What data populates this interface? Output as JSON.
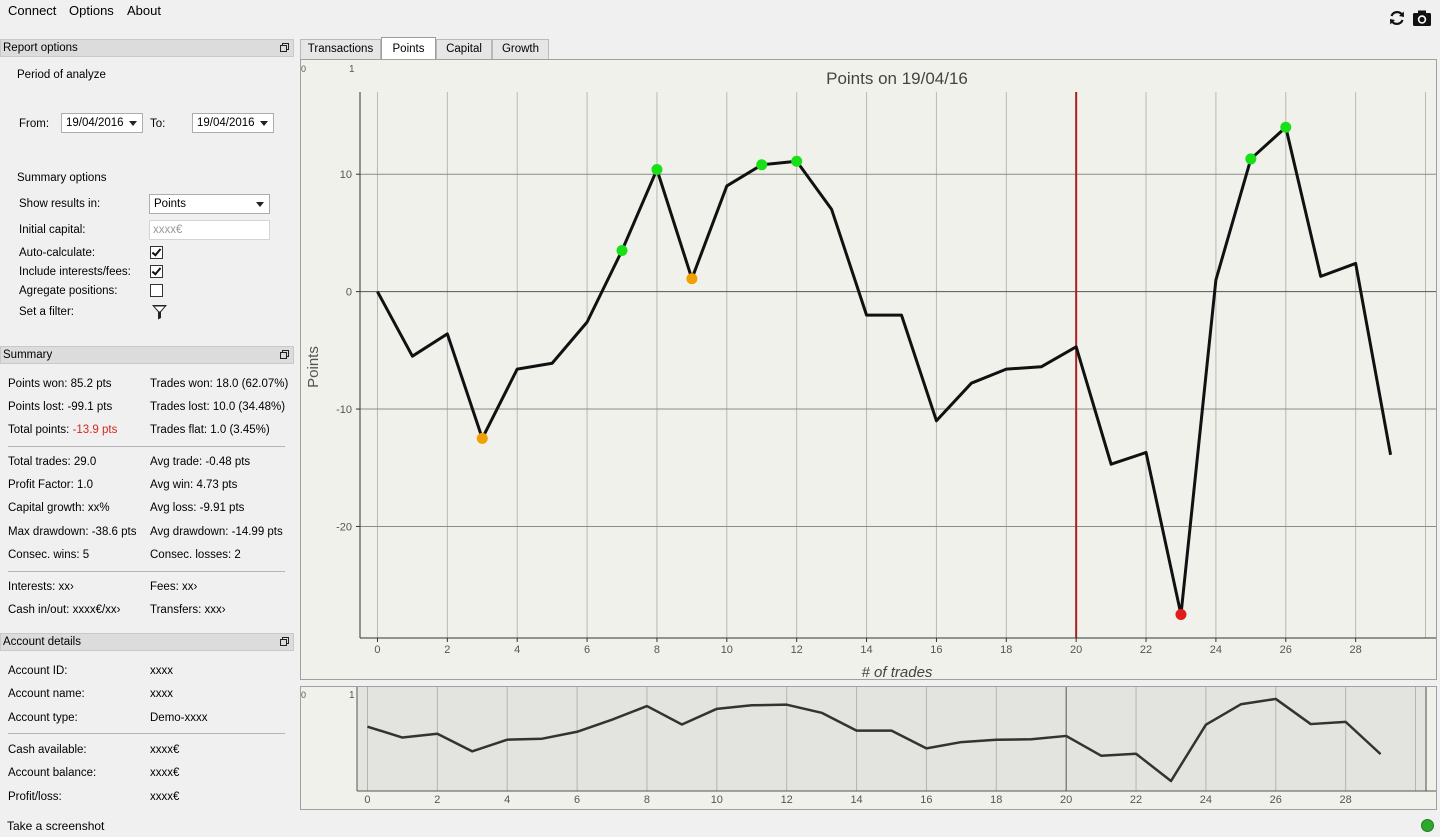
{
  "menu": {
    "connect": "Connect",
    "options": "Options",
    "about": "About"
  },
  "toolbar_icons": {
    "refresh": "refresh-icon",
    "screenshot": "camera-icon"
  },
  "report_options": {
    "header": "Report options",
    "period_label": "Period of analyze",
    "from_label": "From:",
    "from_value": "19/04/2016",
    "to_label": "To:",
    "to_value": "19/04/2016",
    "summary_options_label": "Summary options",
    "show_results_label": "Show results in:",
    "show_results_value": "Points",
    "initial_capital_label": "Initial capital:",
    "initial_capital_placeholder": "xxxx€",
    "auto_calculate_label": "Auto-calculate:",
    "auto_calculate_checked": true,
    "include_interests_label": "Include interests/fees:",
    "include_interests_checked": true,
    "agregate_label": "Agregate positions:",
    "agregate_checked": false,
    "filter_label": "Set a filter:"
  },
  "summary": {
    "header": "Summary",
    "points_won": "Points won: 85.2 pts",
    "trades_won": "Trades won: 18.0 (62.07%)",
    "points_lost": "Points lost: -99.1 pts",
    "trades_lost": "Trades lost: 10.0 (34.48%)",
    "total_points_label": "Total points:",
    "total_points_value": "-13.9 pts",
    "total_points_color": "#d8261c",
    "trades_flat": "Trades flat: 1.0 (3.45%)",
    "total_trades": "Total trades: 29.0",
    "avg_trade": "Avg trade: -0.48 pts",
    "profit_factor": "Profit Factor: 1.0",
    "avg_win": "Avg win: 4.73 pts",
    "capital_growth": "Capital growth: xx%",
    "avg_loss": "Avg loss: -9.91 pts",
    "max_drawdown": "Max drawdown: -38.6 pts",
    "avg_drawdown": "Avg drawdown: -14.99 pts",
    "consec_wins": "Consec. wins: 5",
    "consec_losses": "Consec. losses: 2",
    "interests": "Interests: xx›",
    "fees": "Fees: xx›",
    "cash_in_out": "Cash in/out: xxxx€/xx›",
    "transfers": "Transfers: xxx›"
  },
  "account": {
    "header": "Account details",
    "id_label": "Account ID:",
    "id_value": "xxxx",
    "name_label": "Account name:",
    "name_value": "xxxx",
    "type_label": "Account type:",
    "type_value": "Demo-xxxx",
    "cash_label": "Cash available:",
    "cash_value": "xxxx€",
    "balance_label": "Account balance:",
    "balance_value": "xxxx€",
    "pl_label": "Profit/loss:",
    "pl_value": "xxxx€"
  },
  "tabs": [
    "Transactions",
    "Points",
    "Capital",
    "Growth"
  ],
  "active_tab": "Points",
  "chart_data": {
    "type": "line",
    "title": "Points on 19/04/16",
    "xlabel": "# of trades",
    "ylabel": "Points",
    "xlim": [
      -0.5,
      30.3
    ],
    "ylim": [
      -29.5,
      17
    ],
    "x_ticks": [
      0,
      2,
      4,
      6,
      8,
      10,
      12,
      14,
      16,
      18,
      20,
      22,
      24,
      26,
      28
    ],
    "y_ticks": [
      10,
      0,
      -10,
      -20
    ],
    "y_tick_labels": [
      "10",
      "0",
      "-10",
      "-20"
    ],
    "corner_labels": [
      "0",
      "1"
    ],
    "grid": true,
    "marker_line_x": 20,
    "marker_line_color": "#a82020",
    "line_color": "#111111",
    "x": [
      0,
      1,
      2,
      3,
      4,
      5,
      6,
      7,
      8,
      9,
      10,
      11,
      12,
      13,
      14,
      15,
      16,
      17,
      18,
      19,
      20,
      21,
      22,
      23,
      24,
      25,
      26,
      27,
      28,
      29
    ],
    "y": [
      0,
      -5.5,
      -3.6,
      -12.5,
      -6.6,
      -6.1,
      -2.6,
      3.5,
      10.4,
      1.1,
      9,
      10.8,
      11.1,
      7,
      -2,
      -2,
      -11,
      -7.8,
      -6.6,
      -6.4,
      -4.7,
      -14.7,
      -13.7,
      -27.5,
      1,
      11.3,
      14,
      1.3,
      2.4,
      -13.9
    ],
    "markers": [
      {
        "x": 3,
        "y": -12.5,
        "color": "#f0a000"
      },
      {
        "x": 7,
        "y": 3.5,
        "color": "#17e017"
      },
      {
        "x": 8,
        "y": 10.4,
        "color": "#17e017"
      },
      {
        "x": 9,
        "y": 1.1,
        "color": "#f0a000"
      },
      {
        "x": 11,
        "y": 10.8,
        "color": "#17e017"
      },
      {
        "x": 12,
        "y": 11.1,
        "color": "#17e017"
      },
      {
        "x": 23,
        "y": -27.5,
        "color": "#e21b1b"
      },
      {
        "x": 25,
        "y": 11.3,
        "color": "#17e017"
      },
      {
        "x": 26,
        "y": 14,
        "color": "#17e017"
      }
    ],
    "overview": {
      "x_ticks": [
        0,
        2,
        4,
        6,
        8,
        10,
        12,
        14,
        16,
        18,
        20,
        22,
        24,
        26,
        28
      ],
      "line_color": "#333333"
    }
  },
  "status": {
    "text": "Take a screenshot",
    "led_color": "#2ea72e"
  }
}
